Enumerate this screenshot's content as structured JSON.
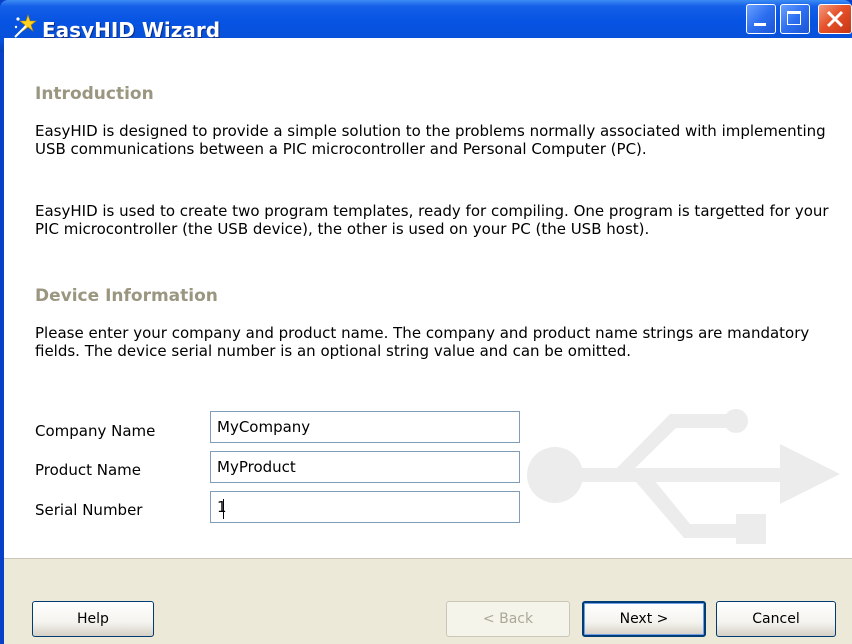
{
  "window": {
    "title": "EasyHID Wizard",
    "icon": "wizard-star-icon",
    "controls": [
      "minimize-icon",
      "maximize-icon",
      "close-icon"
    ]
  },
  "intro": {
    "heading": "Introduction",
    "para1": "EasyHID is designed to provide a simple solution to the problems normally associated with implementing USB communications between a PIC microcontroller and Personal Computer (PC).",
    "para2": "EasyHID is used to create two program templates, ready for compiling. One program is targetted for your PIC microcontroller (the USB device), the other is used on your PC (the USB host)."
  },
  "device": {
    "heading": "Device Information",
    "para": "Please enter your company and product name. The company and product name strings are mandatory fields. The device serial number is an optional string value and can be omitted.",
    "fields": [
      {
        "label": "Company Name",
        "value": "MyCompany"
      },
      {
        "label": "Product Name",
        "value": "MyProduct"
      },
      {
        "label": "Serial Number",
        "value": "1"
      }
    ]
  },
  "buttons": {
    "help": "Help",
    "back": "< Back",
    "next": "Next >",
    "cancel": "Cancel"
  },
  "colors": {
    "titlebar": "#0754e3",
    "heading": "#9a9680",
    "footer": "#ece9d8",
    "close_button": "#e5522a"
  }
}
